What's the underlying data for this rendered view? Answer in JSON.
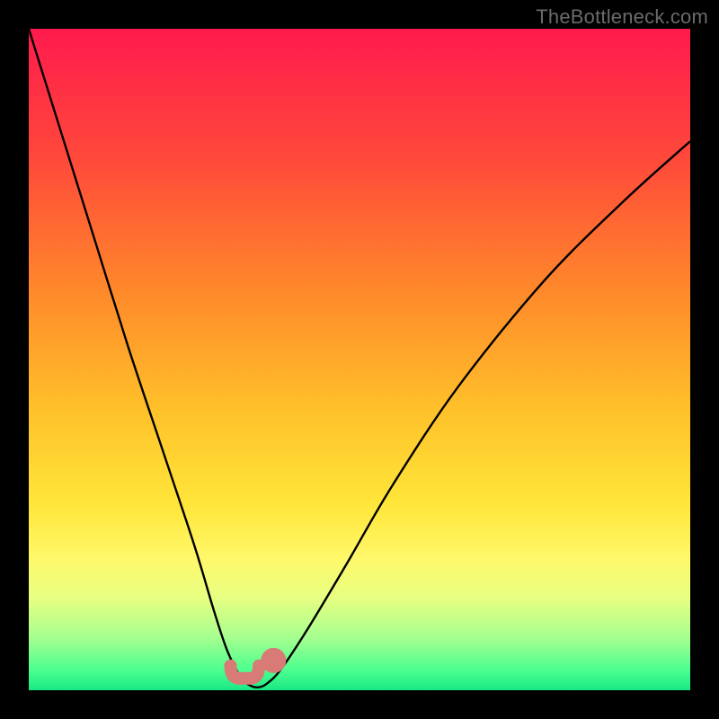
{
  "watermark": "TheBottleneck.com",
  "colors": {
    "frame": "#000000",
    "gradient_stops": [
      {
        "offset": 0.0,
        "color": "#ff1a4d"
      },
      {
        "offset": 0.2,
        "color": "#ff4a3a"
      },
      {
        "offset": 0.4,
        "color": "#ff8a2a"
      },
      {
        "offset": 0.58,
        "color": "#ffc22a"
      },
      {
        "offset": 0.72,
        "color": "#ffe63a"
      },
      {
        "offset": 0.8,
        "color": "#fff86a"
      },
      {
        "offset": 0.86,
        "color": "#e8ff82"
      },
      {
        "offset": 0.92,
        "color": "#a6ff8f"
      },
      {
        "offset": 0.97,
        "color": "#4bff8f"
      },
      {
        "offset": 1.0,
        "color": "#19e884"
      }
    ],
    "curve": "#000000",
    "marker": "#d87a75"
  },
  "chart_data": {
    "type": "line",
    "title": "",
    "xlabel": "",
    "ylabel": "",
    "xlim": [
      0,
      100
    ],
    "ylim": [
      0,
      100
    ],
    "grid": false,
    "legend": false,
    "series": [
      {
        "name": "bottleneck-curve",
        "x": [
          0,
          5,
          10,
          15,
          20,
          25,
          28,
          30,
          32,
          33,
          34,
          35,
          36,
          38,
          42,
          48,
          55,
          65,
          78,
          90,
          100
        ],
        "y": [
          100,
          84,
          68,
          52,
          37,
          22,
          12,
          6,
          2,
          1,
          0.5,
          0.5,
          1,
          3,
          9,
          19,
          31,
          46,
          62,
          74,
          83
        ]
      }
    ],
    "markers": [
      {
        "name": "trough-segment",
        "x_from": 30.5,
        "x_to": 34.8,
        "y": 1.8
      },
      {
        "name": "right-shoulder-dot",
        "x": 37.0,
        "y": 4.5
      }
    ],
    "background_gradient_axis": "y",
    "background_gradient_meaning": "bottleneck-severity (red=high, green=low)"
  }
}
